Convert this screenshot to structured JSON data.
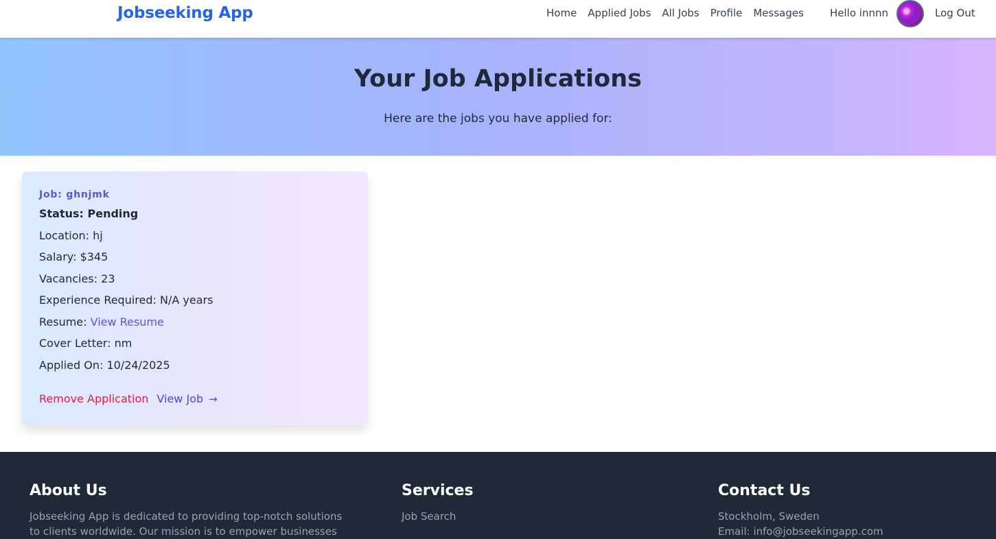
{
  "navbar": {
    "brand": "Jobseeking App",
    "links": [
      "Home",
      "Applied Jobs",
      "All Jobs",
      "Profile",
      "Messages"
    ],
    "greeting": "Hello innnn",
    "logout": "Log Out"
  },
  "hero": {
    "title": "Your Job Applications",
    "subtitle": "Here are the jobs you have applied for:"
  },
  "application": {
    "job_title": "Job: ghnjmk",
    "status": "Status: Pending",
    "location": "Location: hj",
    "salary": "Salary: $345",
    "vacancies": "Vacancies: 23",
    "experience": "Experience Required: N/A years",
    "resume_label": "Resume:",
    "resume_link": "View Resume",
    "cover_letter": "Cover Letter: nm",
    "applied_on": "Applied On: 10/24/2025",
    "remove_label": "Remove Application",
    "view_job_label": "View Job",
    "arrow": "→"
  },
  "footer": {
    "about": {
      "heading": "About Us",
      "text": "Jobseeking App is dedicated to providing top-notch solutions to clients worldwide. Our mission is to empower businesses and job"
    },
    "services": {
      "heading": "Services",
      "items": [
        "Job Search"
      ]
    },
    "contact": {
      "heading": "Contact Us",
      "address": "Stockholm, Sweden",
      "email": "Email: info@jobseekingapp.com"
    }
  }
}
